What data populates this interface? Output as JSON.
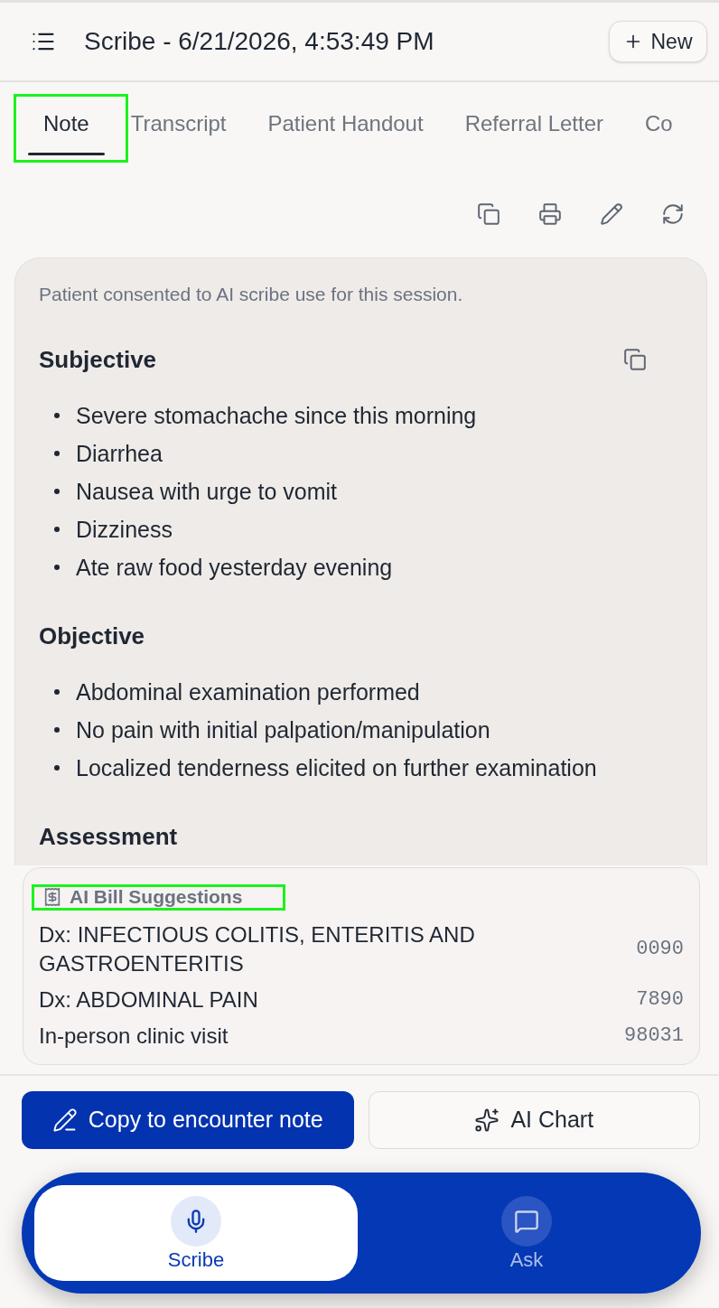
{
  "header": {
    "title": "Scribe - 6/21/2026, 4:53:49 PM",
    "new_button": "New"
  },
  "tabs": [
    {
      "label": "Note",
      "selected": true,
      "highlighted": true
    },
    {
      "label": "Transcript",
      "selected": false,
      "highlighted": false
    },
    {
      "label": "Patient Handout",
      "selected": false,
      "highlighted": false
    },
    {
      "label": "Referral Letter",
      "selected": false,
      "highlighted": false
    },
    {
      "label": "Co",
      "selected": false,
      "highlighted": false
    }
  ],
  "note": {
    "consent": "Patient consented to AI scribe use for this session.",
    "sections": [
      {
        "heading": "Subjective",
        "copy_button": true,
        "items": [
          "Severe stomachache since this morning",
          "Diarrhea",
          "Nausea with urge to vomit",
          "Dizziness",
          "Ate raw food yesterday evening"
        ]
      },
      {
        "heading": "Objective",
        "copy_button": false,
        "items": [
          "Abdominal examination performed",
          "No pain with initial palpation/manipulation",
          "Localized tenderness elicited on further examination"
        ]
      },
      {
        "heading": "Assessment",
        "copy_button": false
      }
    ]
  },
  "bill_suggestions": {
    "title": "AI Bill Suggestions",
    "highlighted": true,
    "rows": [
      {
        "description": "Dx: INFECTIOUS COLITIS, ENTERITIS AND GASTROENTERITIS",
        "code": "0090"
      },
      {
        "description": "Dx: ABDOMINAL PAIN",
        "code": "7890"
      },
      {
        "description": "In-person clinic visit",
        "code": "98031"
      }
    ]
  },
  "actions": [
    {
      "label": "Copy to encounter note",
      "kind": "primary"
    },
    {
      "label": "AI Chart",
      "kind": "secondary"
    }
  ],
  "bottom_nav": [
    {
      "label": "Scribe",
      "kind": "scribe",
      "selected": true
    },
    {
      "label": "Ask",
      "kind": "ask",
      "selected": false
    }
  ]
}
